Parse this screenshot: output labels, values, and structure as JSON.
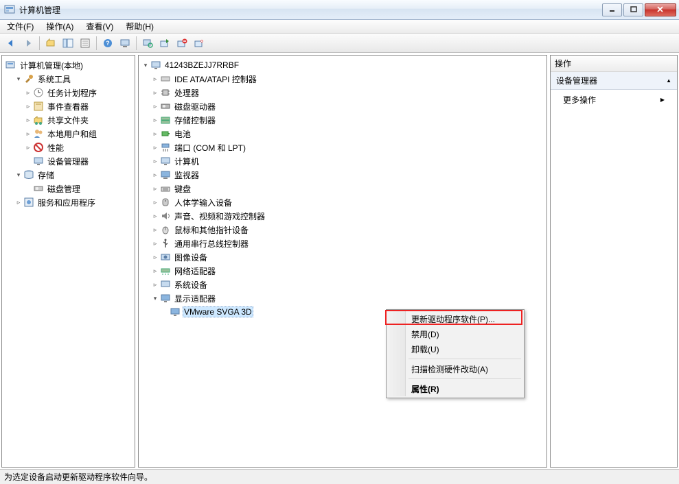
{
  "title": "计算机管理",
  "menus": {
    "file": "文件(F)",
    "action": "操作(A)",
    "view": "查看(V)",
    "help": "帮助(H)"
  },
  "left_tree": {
    "root": "计算机管理(本地)",
    "sys_tools": "系统工具",
    "task_sched": "任务计划程序",
    "event_viewer": "事件查看器",
    "shared": "共享文件夹",
    "local_users": "本地用户和组",
    "perf": "性能",
    "dev_mgr": "设备管理器",
    "storage": "存储",
    "disk_mgmt": "磁盘管理",
    "services": "服务和应用程序"
  },
  "center_tree": {
    "root": "41243BZEJJ7RRBF",
    "ide": "IDE ATA/ATAPI 控制器",
    "cpu": "处理器",
    "disk": "磁盘驱动器",
    "storage_ctrl": "存储控制器",
    "battery": "电池",
    "ports": "端口 (COM 和 LPT)",
    "computer": "计算机",
    "monitor": "监视器",
    "keyboard": "键盘",
    "hid": "人体学输入设备",
    "sound": "声音、视频和游戏控制器",
    "mouse": "鼠标和其他指针设备",
    "usb": "通用串行总线控制器",
    "imaging": "图像设备",
    "network": "网络适配器",
    "system": "系统设备",
    "display": "显示适配器",
    "display_item": "VMware SVGA 3D"
  },
  "ctx": {
    "update": "更新驱动程序软件(P)...",
    "disable": "禁用(D)",
    "uninstall": "卸载(U)",
    "scan": "扫描检测硬件改动(A)",
    "props": "属性(R)"
  },
  "actions": {
    "header": "操作",
    "section": "设备管理器",
    "more": "更多操作"
  },
  "status": "为选定设备启动更新驱动程序软件向导。"
}
